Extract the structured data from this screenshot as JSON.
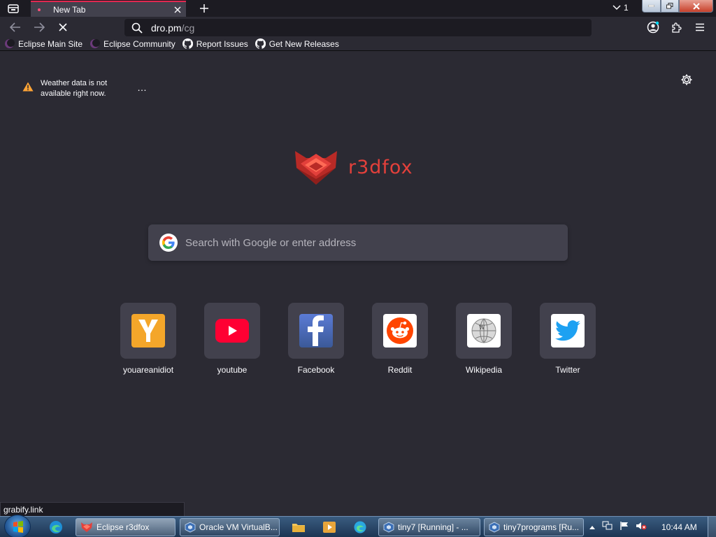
{
  "browser": {
    "tab": {
      "title": "New Tab"
    },
    "tabs_count": "1",
    "url": {
      "host": "dro.pm",
      "path": "/cg"
    },
    "bookmarks": [
      {
        "label": "Eclipse Main Site",
        "icon": "eclipse-icon"
      },
      {
        "label": "Eclipse Community",
        "icon": "eclipse-icon"
      },
      {
        "label": "Report Issues",
        "icon": "github-icon"
      },
      {
        "label": "Get New Releases",
        "icon": "github-icon"
      }
    ],
    "status_text": "grabify.link"
  },
  "newtab": {
    "weather_message": "Weather data is not available right now.",
    "weather_more": "…",
    "logo_text": "r3dfox",
    "search_placeholder": "Search with Google or enter address",
    "top_sites": [
      {
        "label": "youareanidiot",
        "icon": "youareanidiot-icon",
        "color": "#f4a62a"
      },
      {
        "label": "youtube",
        "icon": "youtube-icon",
        "color": "#ff0033"
      },
      {
        "label": "Facebook",
        "icon": "facebook-icon",
        "color": "#3b5998"
      },
      {
        "label": "Reddit",
        "icon": "reddit-icon",
        "color": "#ff4500"
      },
      {
        "label": "Wikipedia",
        "icon": "wikipedia-icon",
        "color": "#ffffff"
      },
      {
        "label": "Twitter",
        "icon": "twitter-icon",
        "color": "#1da1f2"
      }
    ]
  },
  "taskbar": {
    "tasks": [
      {
        "label": "Eclipse r3dfox"
      },
      {
        "label": "Oracle VM VirtualB..."
      },
      {
        "label": "tiny7 [Running] - ..."
      },
      {
        "label": "tiny7programs [Ru..."
      }
    ],
    "clock": "10:44 AM"
  },
  "colors": {
    "accent": "#e22850",
    "background": "#2b2a33",
    "logo": "#e3403b"
  }
}
